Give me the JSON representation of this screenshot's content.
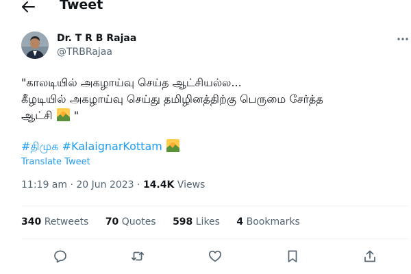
{
  "header": {
    "title": "Tweet",
    "back_icon": "arrow-left-icon"
  },
  "author": {
    "name": "Dr. T R B Rajaa",
    "handle": "@TRBRajaa"
  },
  "tweet": {
    "line1": "\"காலடியில் அகழாய்வு செய்த ஆட்சியல்ல...",
    "line2": "கீழடியில் அகழாய்வு செய்து தமிழினத்திற்கு பெருமை சேர்த்த",
    "line3_text": "ஆட்சி",
    "line3_end": "\"",
    "emoji": "sunrise-over-mountains"
  },
  "hashtags": {
    "tag1": "#திமுக",
    "tag2": "#KalaignarKottam"
  },
  "translate_label": "Translate Tweet",
  "meta": {
    "time": "11:19 am",
    "separator": "·",
    "date": "20 Jun 2023",
    "views_count": "14.4K",
    "views_label": "Views"
  },
  "stats": {
    "retweets": {
      "count": "340",
      "label": "Retweets"
    },
    "quotes": {
      "count": "70",
      "label": "Quotes"
    },
    "likes": {
      "count": "598",
      "label": "Likes"
    },
    "bookmarks": {
      "count": "4",
      "label": "Bookmarks"
    }
  },
  "actions": [
    "reply-icon",
    "retweet-icon",
    "like-icon",
    "bookmark-icon",
    "share-icon"
  ],
  "colors": {
    "link": "#1d9bf0",
    "secondary": "#536471",
    "text": "#0f1419",
    "divider": "#eff3f4"
  }
}
